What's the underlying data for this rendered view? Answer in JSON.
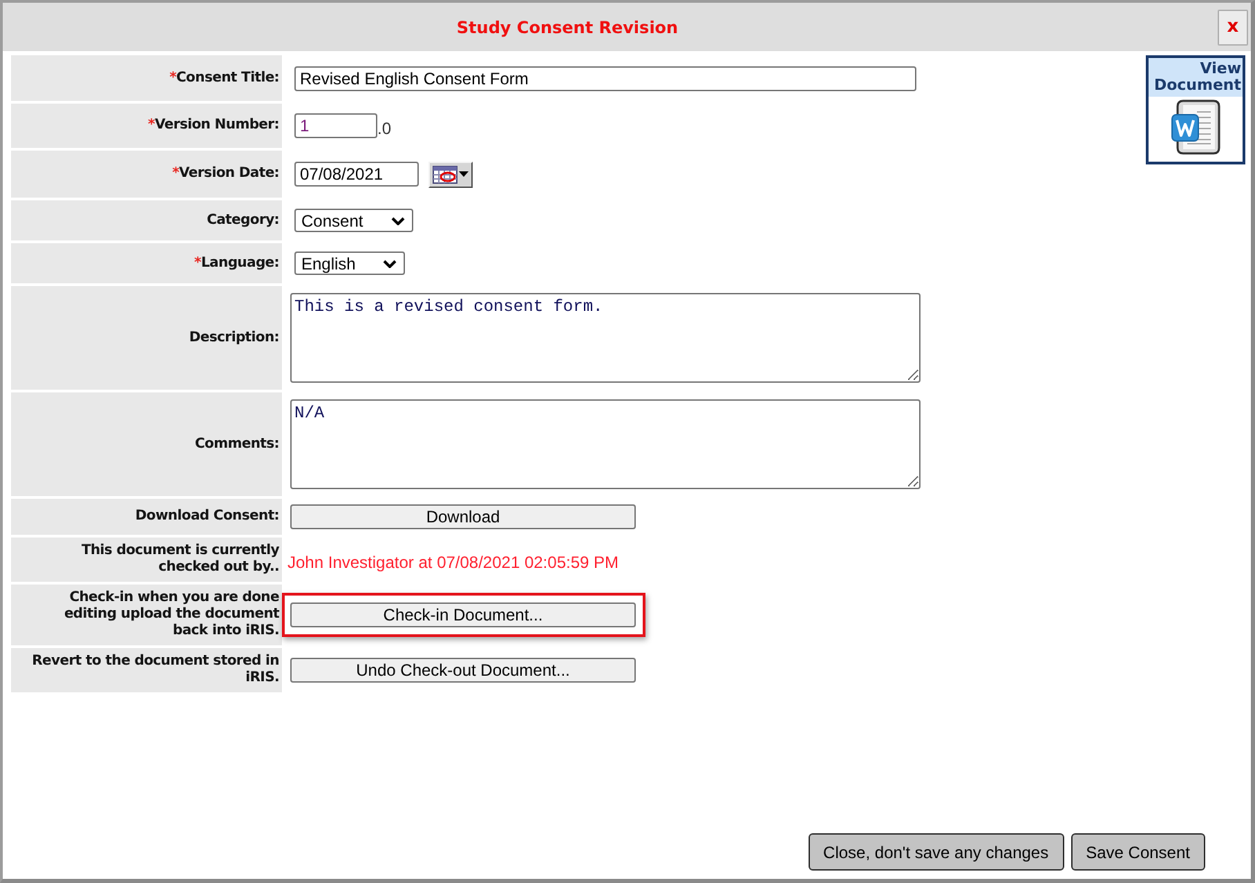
{
  "window": {
    "title": "Study Consent Revision",
    "close_label": "x"
  },
  "fields": [
    {
      "kind": "text",
      "label": "Consent Title:",
      "required_mark": "*",
      "value": "Revised English Consent Form"
    },
    {
      "kind": "version",
      "label": "Version Number:",
      "required_mark": "*",
      "value": "1",
      "suffix": ".0"
    },
    {
      "kind": "date",
      "label": "Version Date:",
      "required_mark": "*",
      "value": "07/08/2021"
    },
    {
      "kind": "select",
      "label": "Category:",
      "value": "Consent"
    },
    {
      "kind": "select",
      "label": "Language:",
      "required_mark": "*",
      "value": "English"
    },
    {
      "kind": "textarea",
      "label": "Description:",
      "value": "This is a revised consent form."
    },
    {
      "kind": "textarea",
      "label": "Comments:",
      "value": "N/A"
    },
    {
      "kind": "button",
      "label": "Download Consent:",
      "button": "Download",
      "highlighted": false
    },
    {
      "kind": "info",
      "label": "This document is currently checked out by..",
      "value": "John Investigator at 07/08/2021 02:05:59 PM"
    },
    {
      "kind": "button",
      "label": "Check-in when you are done editing upload the document back into iRIS.",
      "button": "Check-in Document...",
      "highlighted": true
    },
    {
      "kind": "button",
      "label": "Revert to the document stored in iRIS.",
      "button": "Undo Check-out Document...",
      "highlighted": false
    }
  ],
  "view_document": {
    "label": "View Document"
  },
  "footer_buttons": [
    "Close, don't save any changes",
    "Save Consent"
  ]
}
